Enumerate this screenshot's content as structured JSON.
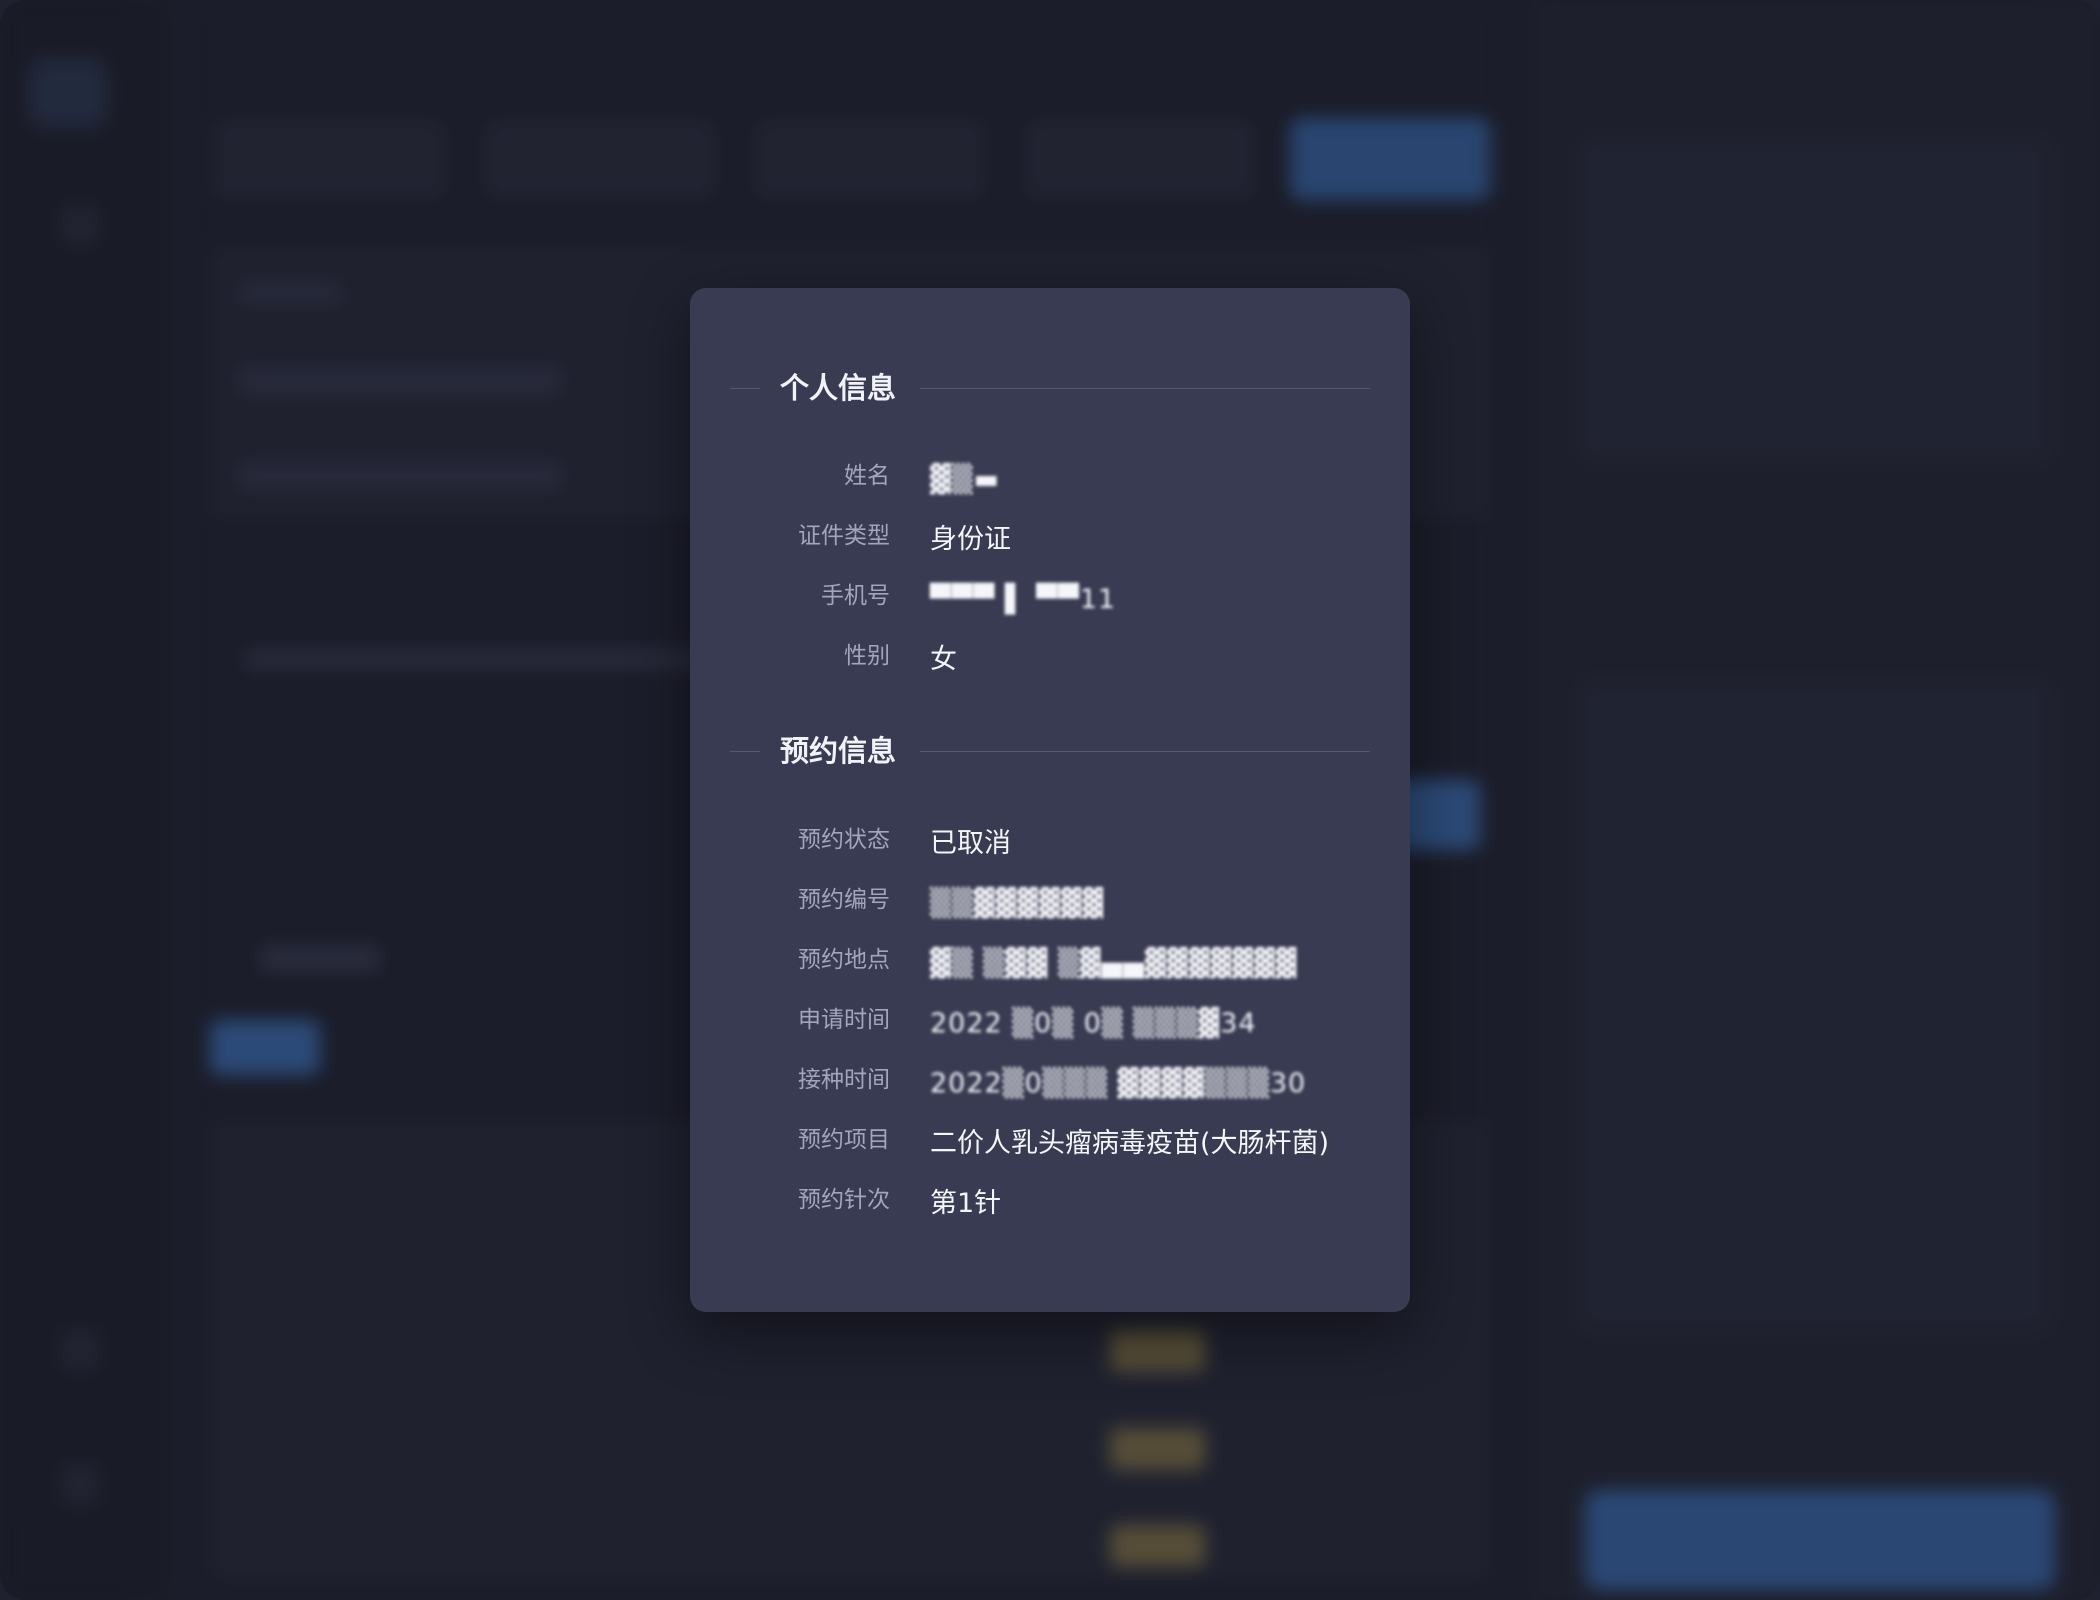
{
  "personal_section": {
    "title": "个人信息",
    "fields": [
      {
        "label": "姓名",
        "value": "▓▒▬",
        "masked": true
      },
      {
        "label": "证件类型",
        "value": "身份证",
        "masked": false
      },
      {
        "label": "手机号",
        "value": "▀▀▀ ▌ ▀▀11",
        "masked": true
      },
      {
        "label": "性别",
        "value": "女",
        "masked": false
      }
    ]
  },
  "booking_section": {
    "title": "预约信息",
    "fields": [
      {
        "label": "预约状态",
        "value": "已取消",
        "masked": false
      },
      {
        "label": "预约编号",
        "value": "▒▒▓▓▓▓▓▓",
        "masked": true
      },
      {
        "label": "预约地点",
        "value": "▓▒ ▒▓▓ ▒▓▄▄▓▓▓▓▓▓▓",
        "masked": true
      },
      {
        "label": "申请时间",
        "value": "2022 ▒0▒ 0▒ ▒▒▒▓34",
        "masked": true
      },
      {
        "label": "接种时间",
        "value": "2022▒0▒▒▒ ▓▓▓▓▒▒▒30",
        "masked": true
      },
      {
        "label": "预约项目",
        "value": "二价人乳头瘤病毒疫苗(大肠杆菌)",
        "masked": false
      },
      {
        "label": "预约针次",
        "value": "第1针",
        "masked": false
      }
    ]
  }
}
